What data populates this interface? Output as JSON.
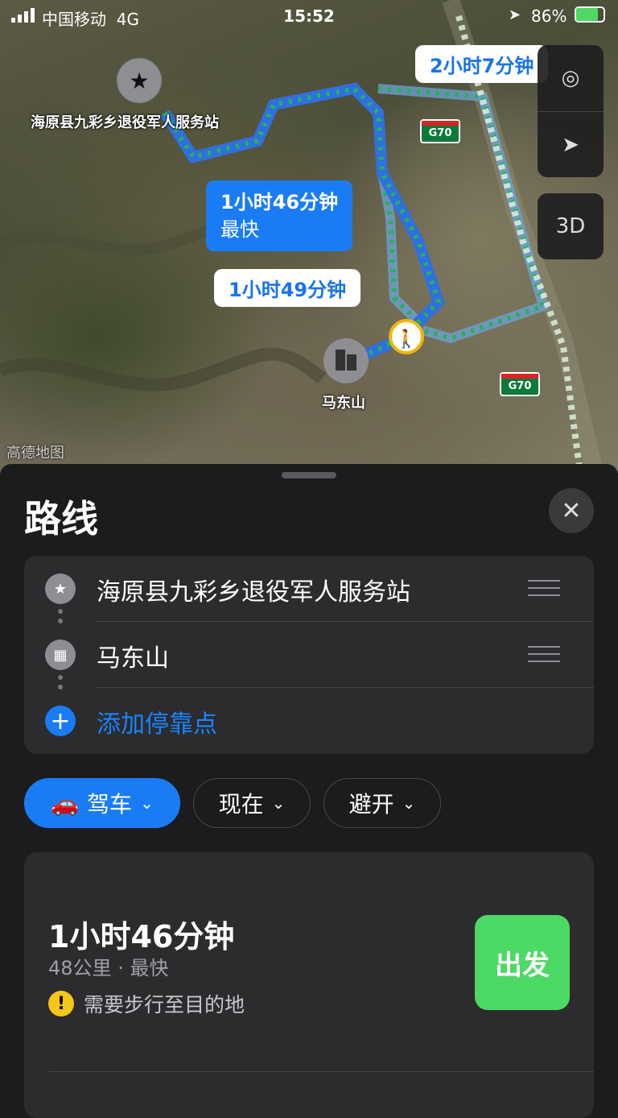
{
  "status_bar": {
    "carrier": "中国移动",
    "network": "4G",
    "time": "15:52",
    "battery": "86%"
  },
  "map": {
    "route_bubbles": [
      "2小时7分钟",
      "1小时49分钟"
    ],
    "fastest_bubble": {
      "duration": "1小时46分钟",
      "tag": "最快"
    },
    "origin_label": "海原县九彩乡退役军人服务站",
    "destination_label": "马东山",
    "highway_labels": [
      "G70",
      "G70"
    ],
    "watermark": "高德地图",
    "controls": {
      "three_d": "3D"
    }
  },
  "sheet": {
    "title": "路线",
    "waypoints": {
      "origin": "海原县九彩乡退役军人服务站",
      "destination": "马东山",
      "add_stop": "添加停靠点"
    },
    "options": {
      "mode": "驾车",
      "time": "现在",
      "avoid": "避开"
    },
    "route_card": {
      "duration": "1小时46分钟",
      "distance": "48公里",
      "tag": "最快",
      "separator": "·",
      "warning": "需要步行至目的地",
      "go": "出发"
    }
  }
}
